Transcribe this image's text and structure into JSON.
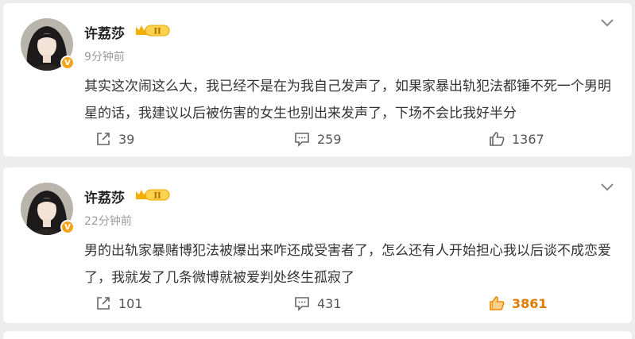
{
  "colors": {
    "background": "#ededed",
    "card": "#ffffff",
    "like_active": "#f08a00",
    "gold_badge": "#f5a31a"
  },
  "posts": [
    {
      "username": "许荔莎",
      "timestamp": "9分钟前",
      "text": "其实这次闹这么大，我已经不是在为我自己发声了，如果家暴出轨犯法都锤不死一个男明星的话，我建议以后被伤害的女生也别出来发声了，下场不会比我好半分",
      "reposts": "39",
      "comments": "259",
      "likes": "1367",
      "liked": false
    },
    {
      "username": "许荔莎",
      "timestamp": "22分钟前",
      "text": "男的出轨家暴赌博犯法被爆出来咋还成受害者了，怎么还有人开始担心我以后谈不成恋爱了，我就发了几条微博就被爱判处终生孤寂了",
      "reposts": "101",
      "comments": "431",
      "likes": "3861",
      "liked": true
    }
  ],
  "icons": {
    "more": "chevron-down-icon",
    "repost": "share-icon",
    "comment": "comment-icon",
    "like": "thumbs-up-icon",
    "verified": "verified-v-icon",
    "level": "crown-level-badge-icon"
  }
}
